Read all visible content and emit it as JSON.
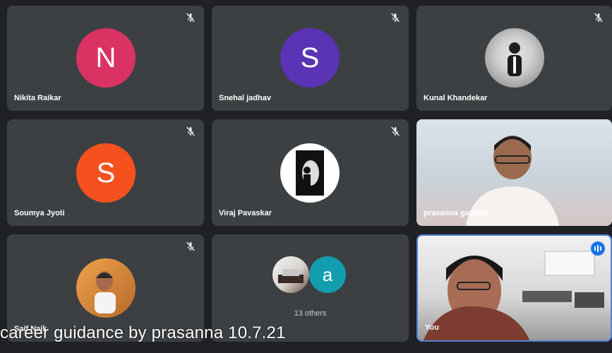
{
  "colors": {
    "page_bg": "#fff8d9",
    "tile_bg": "#3c4043",
    "nikita": "#d93263",
    "snehal": "#5a34b5",
    "soumya": "#f4511e",
    "other_a": "#129eaf",
    "active_border": "#4f83d6"
  },
  "participants": [
    {
      "name": "Nikita Raikar",
      "initial": "N",
      "muted": true
    },
    {
      "name": "Snehal jadhav",
      "initial": "S",
      "muted": true
    },
    {
      "name": "Kunal Khandekar",
      "initial": "",
      "muted": true
    },
    {
      "name": "Soumya Jyoti",
      "initial": "S",
      "muted": true
    },
    {
      "name": "Viraj Pavaskar",
      "initial": "",
      "muted": true
    },
    {
      "name": "prasanna gawade",
      "initial": "",
      "muted": false
    },
    {
      "name": "Saif Naik",
      "initial": "",
      "muted": true
    },
    {
      "name": "",
      "initial": "a",
      "muted": false
    },
    {
      "name": "You",
      "initial": "",
      "muted": false
    }
  ],
  "others_label": "13 others",
  "caption": "career guidance by prasanna 10.7.21",
  "icons": {
    "mute": "mic-off-icon",
    "speaking": "speaking-indicator-icon"
  }
}
